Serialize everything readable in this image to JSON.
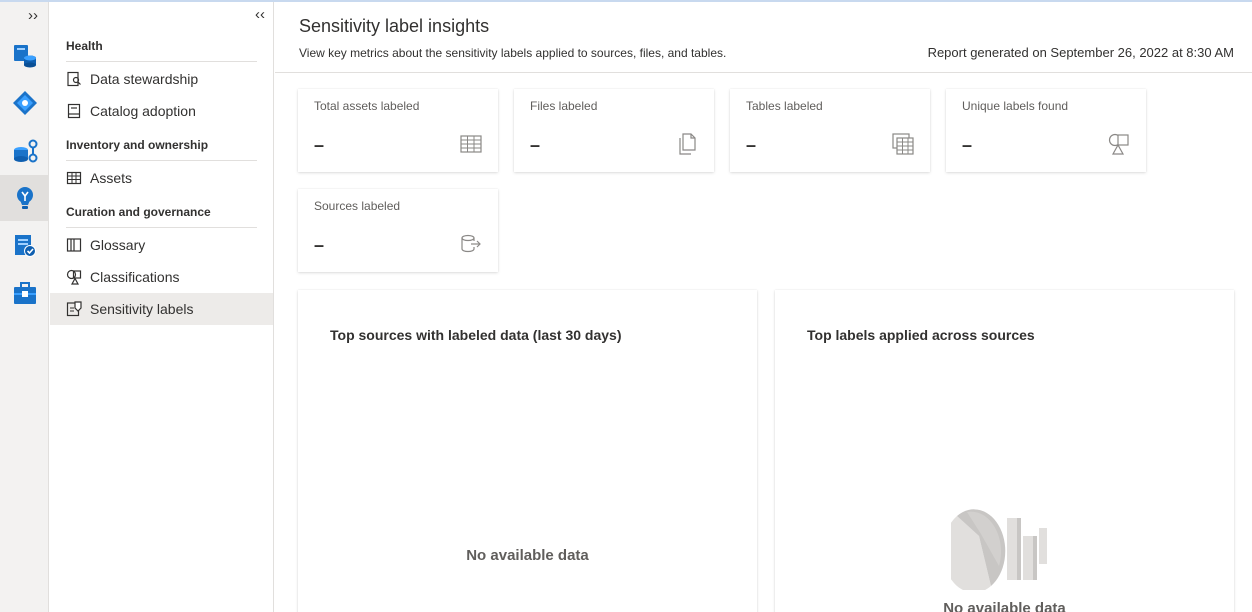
{
  "rail": {
    "expand_label": "››",
    "icons": [
      "data-map-icon",
      "data-catalog-icon",
      "data-sharing-icon",
      "insights-icon",
      "policy-icon",
      "management-icon"
    ]
  },
  "nav": {
    "collapse_label": "‹‹",
    "sections": [
      {
        "heading": "Health",
        "items": [
          {
            "label": "Data stewardship",
            "icon": "data-stewardship-icon"
          },
          {
            "label": "Catalog adoption",
            "icon": "catalog-adoption-icon"
          }
        ]
      },
      {
        "heading": "Inventory and ownership",
        "items": [
          {
            "label": "Assets",
            "icon": "assets-table-icon"
          }
        ]
      },
      {
        "heading": "Curation and governance",
        "items": [
          {
            "label": "Glossary",
            "icon": "glossary-book-icon"
          },
          {
            "label": "Classifications",
            "icon": "classifications-icon"
          },
          {
            "label": "Sensitivity labels",
            "icon": "sensitivity-labels-icon",
            "selected": true
          }
        ]
      }
    ]
  },
  "header": {
    "title": "Sensitivity label insights",
    "subtitle": "View key metrics about the sensitivity labels applied to sources, files, and tables.",
    "report": "Report generated on September 26, 2022 at 8:30 AM"
  },
  "cards": [
    {
      "label": "Total assets labeled",
      "value": "–",
      "icon": "table-grid-icon"
    },
    {
      "label": "Files labeled",
      "value": "–",
      "icon": "files-icon"
    },
    {
      "label": "Tables labeled",
      "value": "–",
      "icon": "tables-icon"
    },
    {
      "label": "Unique labels found",
      "value": "–",
      "icon": "shapes-icon"
    },
    {
      "label": "Sources labeled",
      "value": "–",
      "icon": "database-export-icon"
    }
  ],
  "panels": [
    {
      "title": "Top sources with labeled data (last 30 days)",
      "empty": "No available data"
    },
    {
      "title": "Top labels applied across sources",
      "empty": "No available data"
    }
  ],
  "colors": {
    "accent": "#0078d4",
    "selected_bg": "#edebe9",
    "rail_bg": "#f3f2f1"
  }
}
